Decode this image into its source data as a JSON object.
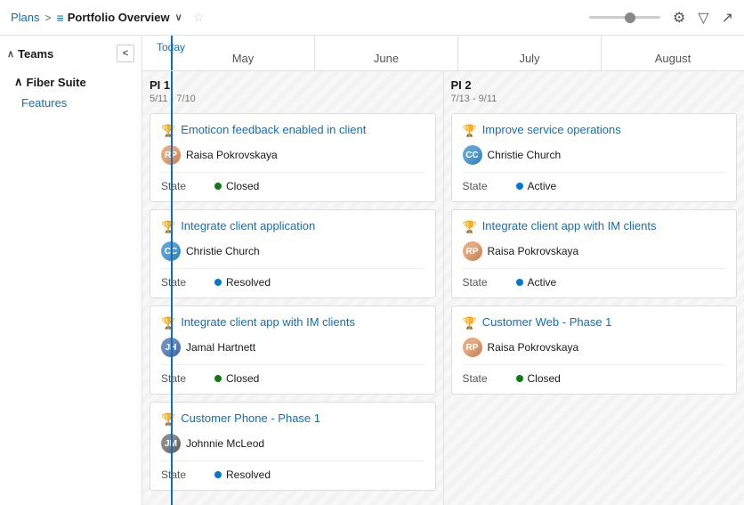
{
  "header": {
    "breadcrumb_plans": "Plans",
    "breadcrumb_separator": ">",
    "portfolio_icon": "☰",
    "portfolio_title": "Portfolio Overview",
    "chevron_down": "∨",
    "star": "☆",
    "zoom_icon": "○",
    "settings_icon": "⚙",
    "filter_icon": "▽",
    "expand_icon": "↗"
  },
  "sidebar": {
    "teams_label": "Teams",
    "collapse_btn": "<",
    "fiber_suite_label": "Fiber Suite",
    "features_label": "Features"
  },
  "timeline": {
    "today_label": "Today",
    "months": [
      "May",
      "June",
      "July",
      "August"
    ]
  },
  "pi1": {
    "label": "PI 1",
    "dates": "5/11 - 7/10",
    "cards": [
      {
        "id": "card1",
        "title": "Emoticon feedback enabled in client",
        "person": "Raisa Pokrovskaya",
        "avatar_type": "rp",
        "state_label": "State",
        "state_dot": "green",
        "state_value": "Closed"
      },
      {
        "id": "card2",
        "title": "Integrate client application",
        "person": "Christie Church",
        "avatar_type": "cc",
        "state_label": "State",
        "state_dot": "blue",
        "state_value": "Resolved"
      },
      {
        "id": "card3",
        "title": "Integrate client app with IM clients",
        "person": "Jamal Hartnett",
        "avatar_type": "jh",
        "state_label": "State",
        "state_dot": "green",
        "state_value": "Closed"
      },
      {
        "id": "card4",
        "title": "Customer Phone - Phase 1",
        "person": "Johnnie McLeod",
        "avatar_type": "jm",
        "state_label": "State",
        "state_dot": "blue",
        "state_value": "Resolved"
      }
    ]
  },
  "pi2": {
    "label": "PI 2",
    "dates": "7/13 - 9/11",
    "cards": [
      {
        "id": "card5",
        "title": "Improve service operations",
        "person": "Christie Church",
        "avatar_type": "cc",
        "state_label": "State",
        "state_dot": "blue",
        "state_value": "Active"
      },
      {
        "id": "card6",
        "title": "Integrate client app with IM clients",
        "person": "Raisa Pokrovskaya",
        "avatar_type": "rp",
        "state_label": "State",
        "state_dot": "blue",
        "state_value": "Active"
      },
      {
        "id": "card7",
        "title": "Customer Web - Phase 1",
        "person": "Raisa Pokrovskaya",
        "avatar_type": "rp",
        "state_label": "State",
        "state_dot": "green",
        "state_value": "Closed"
      }
    ]
  }
}
